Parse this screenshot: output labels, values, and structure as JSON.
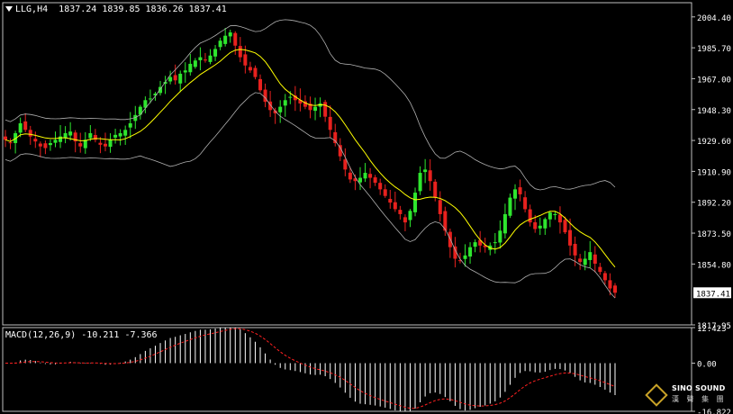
{
  "window": {
    "symbol_header": "LLG,H4",
    "ohlc_header": "1837.24 1839.85 1836.26 1837.41"
  },
  "indicator": {
    "macd_header": "MACD(12,26,9) -10.211 -7.366"
  },
  "colors": {
    "background": "#000000",
    "bull_candle": "#2ee62e",
    "bear_candle": "#e8211e",
    "bollinger": "#b0b0b0",
    "moving_average": "#ffff00",
    "macd_histogram": "#ffffff",
    "macd_signal": "#ff2020",
    "current_price_label_bg": "#ffffff"
  },
  "logo": {
    "text_line1": "SINO SOUND",
    "text_line2": "漢 聲 集 團",
    "icon": "diamond-logo-icon"
  },
  "chart_data": [
    {
      "type": "candlestick",
      "title": "LLG,H4",
      "ylim": [
        1817.95,
        2013.0
      ],
      "yticks": [
        2004.4,
        1985.7,
        1967.0,
        1948.3,
        1929.6,
        1910.9,
        1892.2,
        1873.5,
        1854.8,
        1817.95
      ],
      "ytick_labels": [
        "2004.40",
        "1985.70",
        "1967.00",
        "1948.30",
        "1929.60",
        "1910.90",
        "1892.20",
        "1873.50",
        "1854.80",
        "1817.95"
      ],
      "current_price": "1837.41",
      "grid": false,
      "close": [
        1930,
        1928,
        1934,
        1940,
        1936,
        1932,
        1929,
        1926,
        1925,
        1928,
        1930,
        1932,
        1934,
        1935,
        1929,
        1926,
        1930,
        1934,
        1930,
        1927,
        1926,
        1930,
        1933,
        1934,
        1936,
        1940,
        1945,
        1950,
        1954,
        1955,
        1958,
        1962,
        1965,
        1968,
        1966,
        1970,
        1972,
        1976,
        1978,
        1980,
        1978,
        1981,
        1985,
        1990,
        1993,
        1995,
        1987,
        1980,
        1975,
        1972,
        1968,
        1960,
        1953,
        1948,
        1946,
        1950,
        1954,
        1956,
        1954,
        1952,
        1950,
        1948,
        1950,
        1952,
        1944,
        1936,
        1928,
        1920,
        1912,
        1906,
        1905,
        1907,
        1910,
        1907,
        1904,
        1900,
        1896,
        1892,
        1888,
        1885,
        1880,
        1887,
        1898,
        1910,
        1912,
        1905,
        1895,
        1885,
        1875,
        1865,
        1858,
        1857,
        1860,
        1865,
        1868,
        1866,
        1865,
        1866,
        1868,
        1875,
        1885,
        1895,
        1900,
        1897,
        1888,
        1880,
        1876,
        1878,
        1882,
        1886,
        1885,
        1880,
        1874,
        1866,
        1860,
        1856,
        1858,
        1862,
        1855,
        1850,
        1845,
        1840,
        1837.41
      ]
    },
    {
      "type": "macd",
      "title": "MACD(12,26,9)",
      "macd_value": -10.211,
      "signal_value": -7.366,
      "ylim": [
        -16.822,
        12.423
      ],
      "yticks": [
        12.423,
        0.0,
        -16.822
      ],
      "ytick_labels": [
        "12.423",
        "0.00",
        "-16.822"
      ]
    }
  ]
}
